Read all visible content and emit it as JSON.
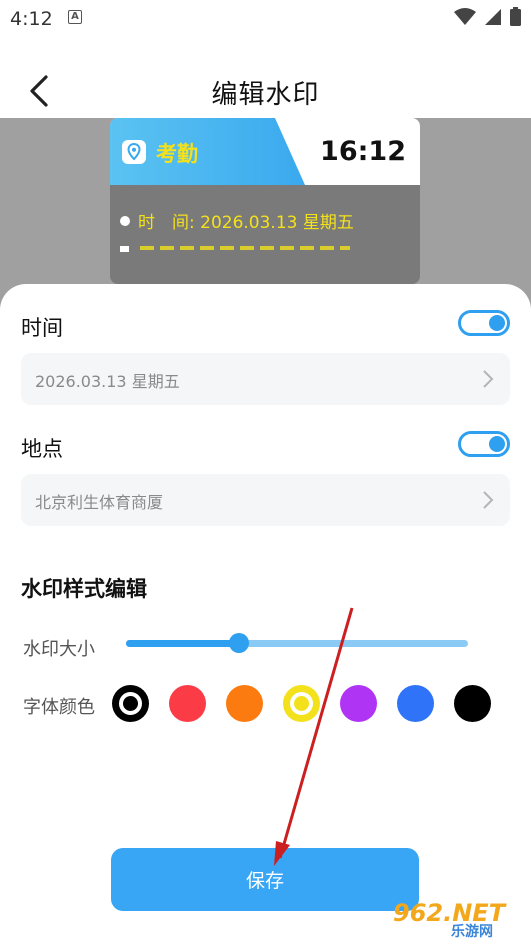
{
  "status_bar": {
    "time": "4:12",
    "notification_letter": "A"
  },
  "header": {
    "title": "编辑水印"
  },
  "watermark_preview": {
    "label": "考勤",
    "clock": "16:12",
    "time_line": "时　间: 2026.03.13 星期五"
  },
  "time_section": {
    "label": "时间",
    "toggle_on": true,
    "value": "2026.03.13 星期五"
  },
  "location_section": {
    "label": "地点",
    "toggle_on": true,
    "value": "北京利生体育商厦"
  },
  "style_section": {
    "title": "水印样式编辑",
    "size_label": "水印大小",
    "size_level": 0.33,
    "color_label": "字体颜色",
    "colors": [
      "#000000",
      "#fb3b45",
      "#fb7b10",
      "#f3e11b",
      "#b034f4",
      "#2f73f9",
      "#000000"
    ],
    "selected_colors": [
      0,
      3
    ]
  },
  "save_button": {
    "label": "保存"
  },
  "site_logo": {
    "main": "962.NET",
    "sub": "乐游网"
  },
  "accent_color": "#2f9ff0"
}
